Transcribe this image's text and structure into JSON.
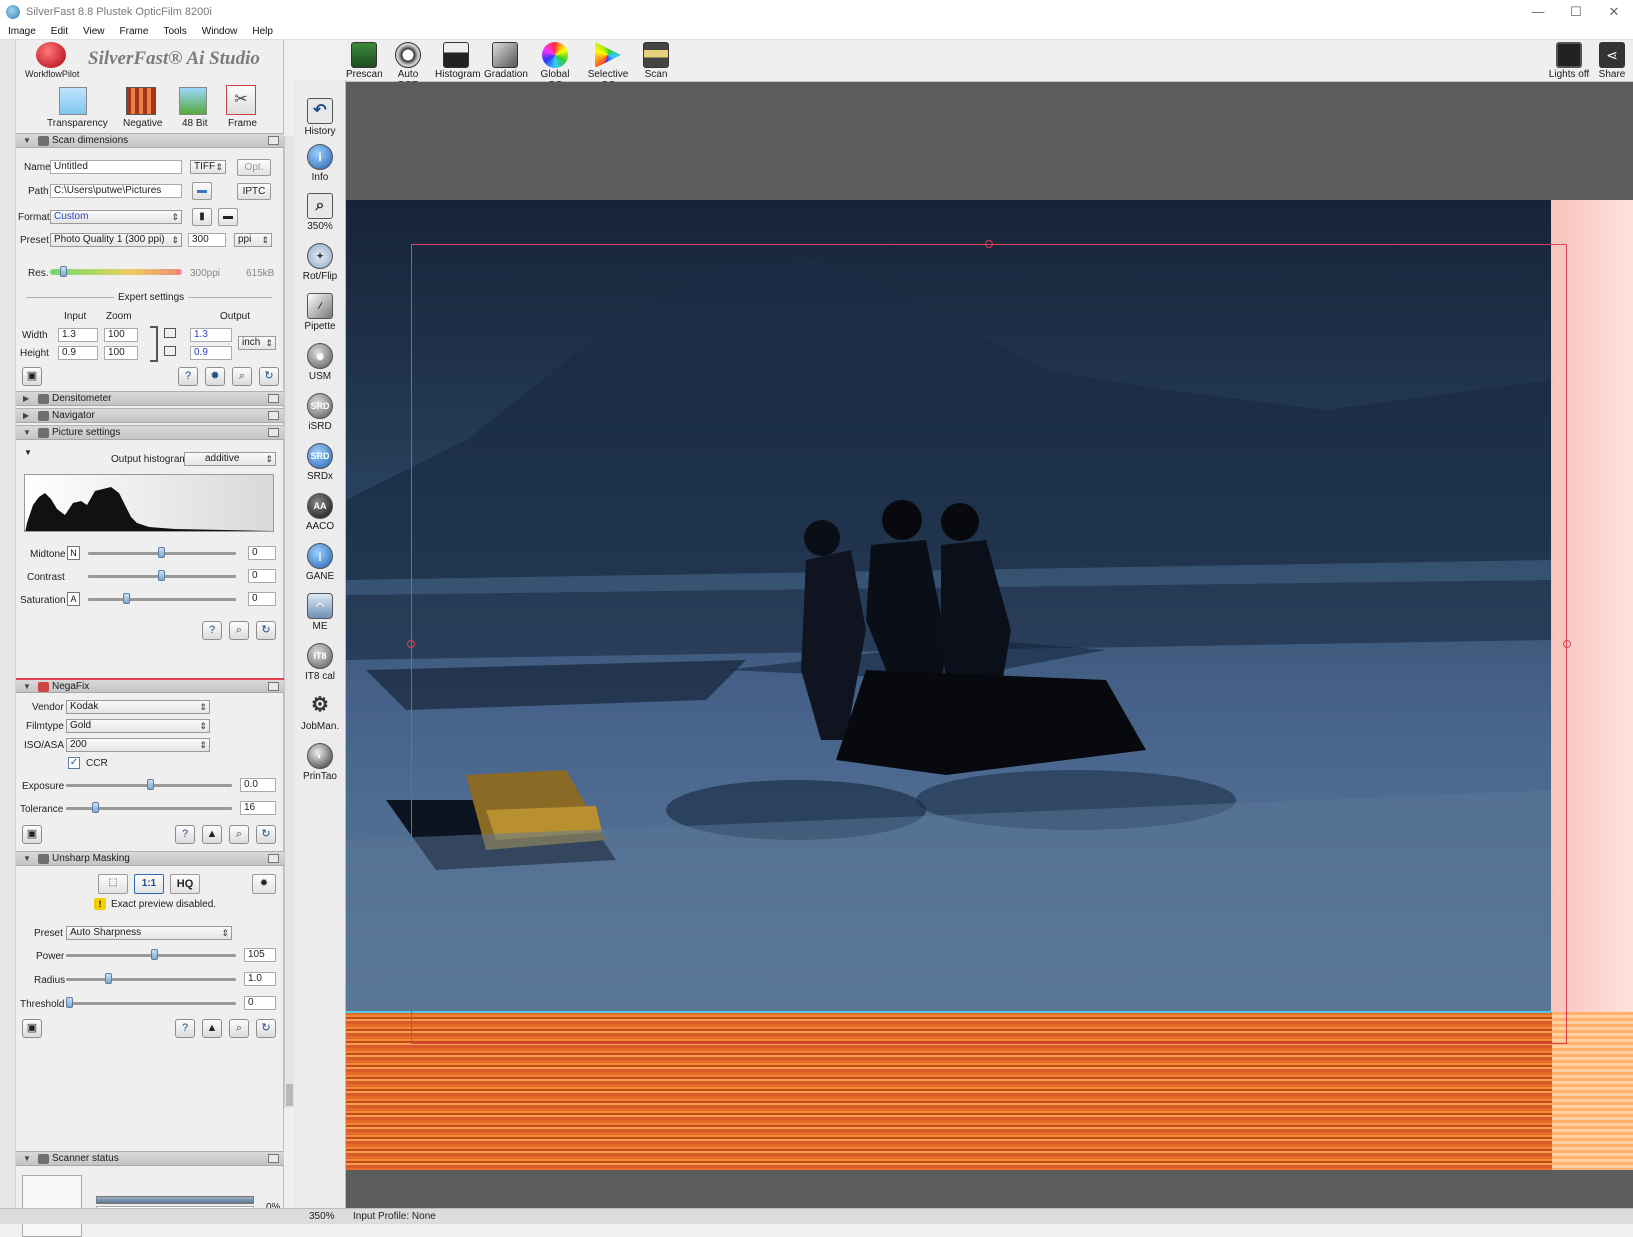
{
  "window": {
    "title": "SilverFast 8.8 Plustek OpticFilm 8200i"
  },
  "menu": [
    "Image",
    "Edit",
    "View",
    "Frame",
    "Tools",
    "Window",
    "Help"
  ],
  "brand": {
    "workflow_label": "WorkflowPilot",
    "logo_text": "SilverFast® Ai Studio"
  },
  "mode_buttons": [
    "Transparency",
    "Negative",
    "48 Bit",
    "Frame"
  ],
  "toolbar": {
    "items": [
      "Prescan",
      "Auto CCR",
      "Histogram",
      "Gradation",
      "Global CC",
      "Selective CC",
      "Scan"
    ],
    "right_items": [
      "Lights off",
      "Share"
    ]
  },
  "tools": [
    "History",
    "Info",
    "350%",
    "Rot/Flip",
    "Pipette",
    "USM",
    "iSRD",
    "SRDx",
    "AACO",
    "GANE",
    "ME",
    "IT8 cal",
    "JobMan.",
    "PrinTao"
  ],
  "scan_dimensions": {
    "title": "Scan dimensions",
    "name_label": "Name",
    "name_value": "Untitled",
    "file_type": "TIFF",
    "opt_button": "Opt.",
    "path_label": "Path",
    "path_value": "C:\\Users\\putwe\\Pictures",
    "iptc_button": "IPTC",
    "format_label": "Format",
    "format_value": "Custom",
    "preset_label": "Preset",
    "preset_value": "Photo Quality 1 (300 ppi)",
    "ppi_value": "300",
    "ppi_unit": "ppi",
    "res_label": "Res.",
    "res_ppi": "300ppi",
    "res_size": "615kB",
    "expert_title": "Expert settings",
    "col_input": "Input",
    "col_zoom": "Zoom",
    "col_output": "Output",
    "width_label": "Width",
    "width_input": "1.3",
    "width_zoom": "100",
    "width_output": "1.3",
    "height_label": "Height",
    "height_input": "0.9",
    "height_zoom": "100",
    "height_output": "0.9",
    "unit": "inch"
  },
  "sections": {
    "densitometer": "Densitometer",
    "navigator": "Navigator",
    "picture_settings": "Picture settings",
    "negafix": "NegaFix",
    "usm": "Unsharp Masking",
    "scanner_status": "Scanner status"
  },
  "picture_settings": {
    "histogram_label": "Output histogram",
    "histogram_mode": "additive",
    "midtone_label": "Midtone",
    "midtone_badge": "N",
    "midtone_value": "0",
    "contrast_label": "Contrast",
    "contrast_value": "0",
    "saturation_label": "Saturation",
    "saturation_badge": "A",
    "saturation_value": "0"
  },
  "negafix": {
    "vendor_label": "Vendor",
    "vendor_value": "Kodak",
    "filmtype_label": "Filmtype",
    "filmtype_value": "Gold",
    "iso_label": "ISO/ASA",
    "iso_value": "200",
    "ccr_label": "CCR",
    "exposure_label": "Exposure",
    "exposure_value": "0.0",
    "tolerance_label": "Tolerance",
    "tolerance_value": "16"
  },
  "usm": {
    "hq_label": "HQ",
    "one_to_one": "1:1",
    "warning": "Exact preview disabled.",
    "preset_label": "Preset",
    "preset_value": "Auto Sharpness",
    "power_label": "Power",
    "power_value": "105",
    "radius_label": "Radius",
    "radius_value": "1.0",
    "threshold_label": "Threshold",
    "threshold_value": "0"
  },
  "scanner_status": {
    "progress": "0%"
  },
  "statusbar": {
    "zoom": "350%",
    "profile": "Input Profile: None"
  },
  "colors": {
    "accent_red": "#e04050",
    "panel_header": "#c8c8c8",
    "canvas_bg": "#5c5c5c"
  }
}
